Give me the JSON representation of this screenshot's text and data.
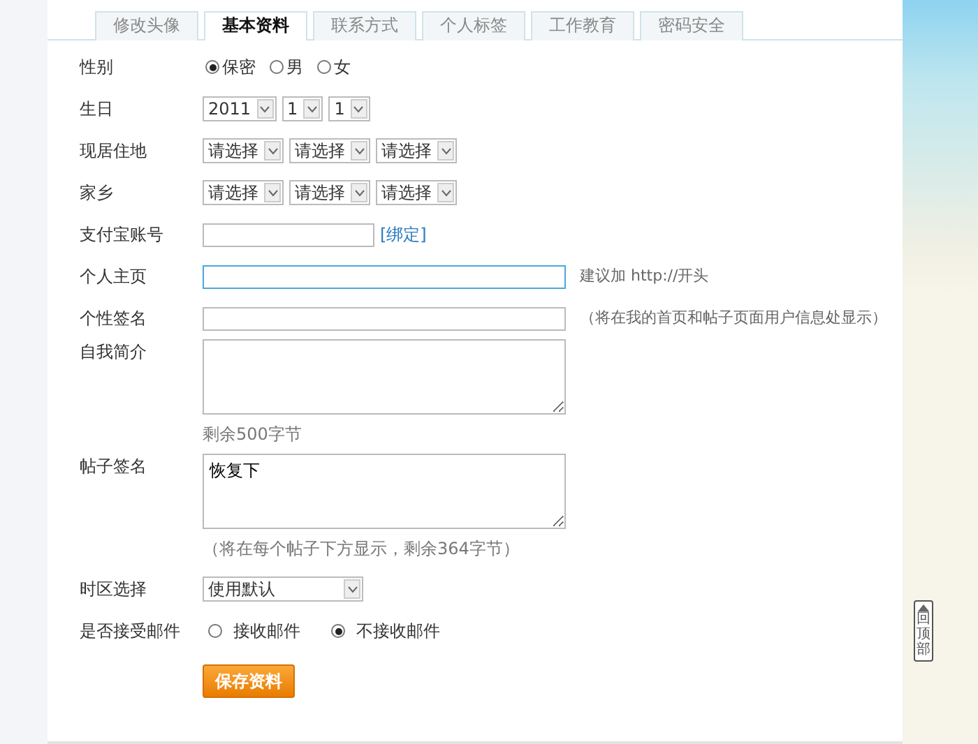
{
  "tabs": [
    {
      "label": "修改头像",
      "selected": false
    },
    {
      "label": "基本资料",
      "selected": true
    },
    {
      "label": "联系方式",
      "selected": false
    },
    {
      "label": "个人标签",
      "selected": false
    },
    {
      "label": "工作教育",
      "selected": false
    },
    {
      "label": "密码安全",
      "selected": false
    }
  ],
  "fields": [
    {
      "kind": "radio",
      "label": "性别",
      "options": [
        {
          "label": "保密",
          "selected": true
        },
        {
          "label": "男",
          "selected": false
        },
        {
          "label": "女",
          "selected": false
        }
      ]
    },
    {
      "kind": "selects",
      "label": "生日",
      "selects": [
        "2011",
        "1",
        "1"
      ]
    },
    {
      "kind": "selects",
      "label": "现居住地",
      "selects": [
        "请选择",
        "请选择",
        "请选择"
      ]
    },
    {
      "kind": "selects",
      "label": "家乡",
      "selects": [
        "请选择",
        "请选择",
        "请选择"
      ]
    },
    {
      "kind": "text",
      "label": "支付宝账号",
      "focused": false,
      "link": "[绑定]"
    },
    {
      "kind": "text",
      "label": "个人主页",
      "focused": true,
      "hint": "建议加 http://开头"
    },
    {
      "kind": "text",
      "label": "个性签名",
      "focused": false,
      "hint": "（将在我的首页和帖子页面用户信息处显示）"
    },
    {
      "kind": "textarea",
      "label": "自我简介",
      "note": "剩余500字节"
    },
    {
      "kind": "textarea",
      "label": "帖子签名",
      "value": "恢复下",
      "note": "（将在每个帖子下方显示，剩余364字节）"
    },
    {
      "kind": "select",
      "label": "时区选择",
      "value": "使用默认"
    },
    {
      "kind": "radio",
      "label": "是否接受邮件",
      "options": [
        {
          "label": "接收邮件",
          "selected": false
        },
        {
          "label": "不接收邮件",
          "selected": true
        }
      ]
    }
  ],
  "save_button": "保存资料",
  "back_to_top": "回顶部"
}
